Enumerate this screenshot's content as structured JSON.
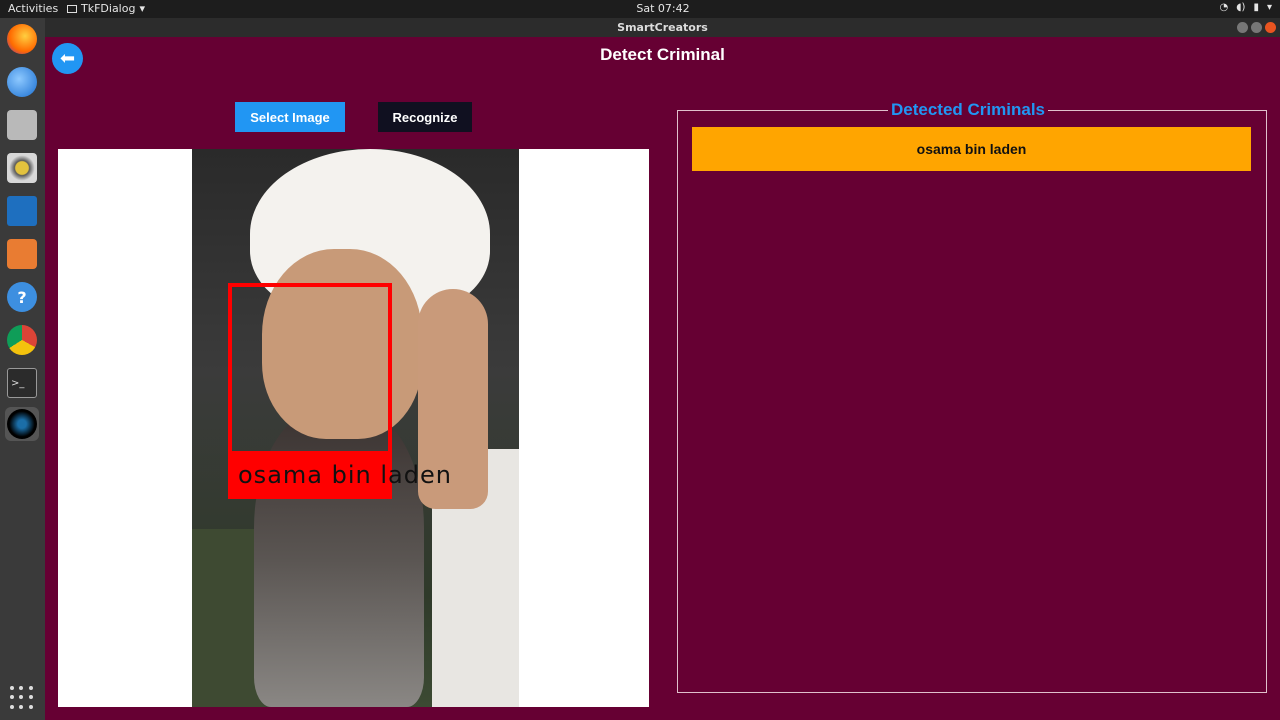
{
  "topbar": {
    "activities": "Activities",
    "app_menu": "TkFDialog",
    "clock": "Sat 07:42"
  },
  "dock": {
    "items": [
      "firefox-icon",
      "thunderbird-icon",
      "files-icon",
      "rhythmbox-icon",
      "writer-icon",
      "software-icon",
      "help-icon",
      "chrome-icon",
      "terminal-icon",
      "smartcreators-icon"
    ]
  },
  "window": {
    "title": "SmartCreators"
  },
  "app": {
    "page_title": "Detect Criminal",
    "select_button": "Select Image",
    "recognize_button": "Recognize",
    "face_label": "osama bin laden",
    "results_legend": "Detected Criminals",
    "results": [
      "osama bin laden"
    ]
  },
  "colors": {
    "background": "#660033",
    "accent": "#2196f3",
    "result_bg": "#ffa500",
    "face_box": "#ff0000"
  }
}
